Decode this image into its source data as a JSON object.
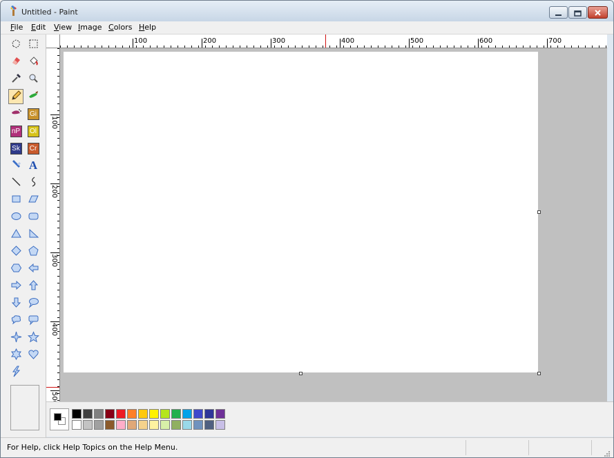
{
  "window": {
    "title": "Untitled - Paint",
    "icons": {
      "app": "paint-brush-icon",
      "min": "minimize-icon",
      "max": "maximize-icon",
      "close": "close-icon"
    }
  },
  "menu": [
    {
      "label": "File",
      "key": "F",
      "rest": "ile"
    },
    {
      "label": "Edit",
      "key": "E",
      "rest": "dit"
    },
    {
      "label": "View",
      "key": "V",
      "rest": "iew"
    },
    {
      "label": "Image",
      "key": "I",
      "rest": "mage"
    },
    {
      "label": "Colors",
      "key": "C",
      "rest": "olors"
    },
    {
      "label": "Help",
      "key": "H",
      "rest": "elp"
    }
  ],
  "tools": [
    {
      "name": "free-form-select-icon"
    },
    {
      "name": "select-icon"
    },
    {
      "name": "eraser-icon"
    },
    {
      "name": "fill-bucket-icon"
    },
    {
      "name": "color-picker-icon"
    },
    {
      "name": "magnifier-icon"
    },
    {
      "name": "pencil-icon",
      "selected": true
    },
    {
      "name": "brush-icon"
    },
    {
      "name": "airbrush-icon"
    },
    {
      "name": "gi-plugin-icon",
      "label": "Gi",
      "color": "#c8922c"
    },
    {
      "name": "np-plugin-icon",
      "label": "nP",
      "color": "#b0307a"
    },
    {
      "name": "ol-plugin-icon",
      "label": "Ol",
      "color": "#d6c21a"
    },
    {
      "name": "sk-plugin-icon",
      "label": "Sk",
      "color": "#2f3a8a"
    },
    {
      "name": "cr-plugin-icon",
      "label": "Cr",
      "color": "#c85a2c"
    },
    {
      "name": "paint-tube-icon"
    },
    {
      "name": "text-tool-icon",
      "label": "A"
    },
    {
      "name": "line-icon"
    },
    {
      "name": "curve-icon"
    },
    {
      "name": "rectangle-icon"
    },
    {
      "name": "parallelogram-icon"
    },
    {
      "name": "ellipse-icon"
    },
    {
      "name": "rounded-rectangle-icon"
    },
    {
      "name": "triangle-icon"
    },
    {
      "name": "right-triangle-icon"
    },
    {
      "name": "diamond-icon"
    },
    {
      "name": "pentagon-icon"
    },
    {
      "name": "hexagon-icon"
    },
    {
      "name": "left-arrow-icon"
    },
    {
      "name": "right-arrow-icon"
    },
    {
      "name": "up-arrow-icon"
    },
    {
      "name": "down-arrow-icon"
    },
    {
      "name": "speech-bubble-oval-icon"
    },
    {
      "name": "cloud-callout-icon"
    },
    {
      "name": "speech-bubble-rect-icon"
    },
    {
      "name": "four-point-star-icon"
    },
    {
      "name": "five-point-star-icon"
    },
    {
      "name": "six-point-star-icon"
    },
    {
      "name": "heart-icon"
    },
    {
      "name": "lightning-icon"
    }
  ],
  "ruler": {
    "h_labels": [
      "100",
      "200",
      "300",
      "400",
      "500",
      "600",
      "700"
    ],
    "v_labels": [
      "100",
      "200",
      "300",
      "400",
      "500"
    ]
  },
  "palette": {
    "foreground": "#000000",
    "background": "#ffffff",
    "top_row": [
      "#000000",
      "#404040",
      "#808080",
      "#880015",
      "#ed1c24",
      "#ff7f27",
      "#ffc90e",
      "#fff200",
      "#b5e61d",
      "#22b14c",
      "#00a2e8",
      "#3f48cc",
      "#2f3699",
      "#6f3198"
    ],
    "bottom_row": [
      "#ffffff",
      "#c3c3c3",
      "#a0a0a0",
      "#8b5a2b",
      "#ffaec9",
      "#e0a878",
      "#f5d28c",
      "#fff3a0",
      "#d8f0a8",
      "#90b060",
      "#99d9ea",
      "#7092be",
      "#506080",
      "#c8bfe7"
    ]
  },
  "status": {
    "help_text": "For Help, click Help Topics on the Help Menu."
  }
}
